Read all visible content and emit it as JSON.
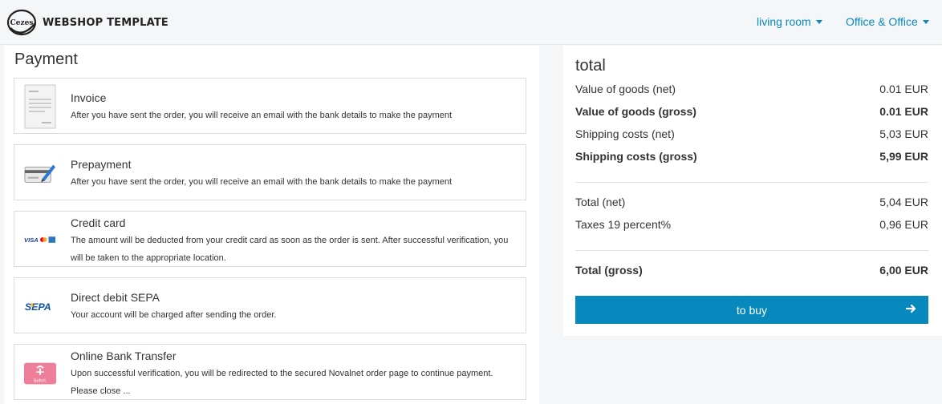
{
  "header": {
    "logo_mark": "Cezes",
    "brand": "WEBSHOP TEMPLATE",
    "nav": [
      {
        "label": "living room"
      },
      {
        "label": "Office & Office"
      }
    ]
  },
  "payment": {
    "title": "Payment",
    "methods": [
      {
        "name": "Invoice",
        "description": "After you have sent the order, you will receive an email with the bank details to make the payment",
        "icon": "invoice-document-icon"
      },
      {
        "name": "Prepayment",
        "description": "After you have sent the order, you will receive an email with the bank details to make the payment",
        "icon": "prepayment-card-pen-icon"
      },
      {
        "name": "Credit card",
        "description": "The amount will be deducted from your credit card as soon as the order is sent. After successful verification, you will be taken to the appropriate location.",
        "icon": "credit-card-logos-icon",
        "icon_text": "VISA"
      },
      {
        "name": "Direct debit SEPA",
        "description": "Your account will be charged after sending the order.",
        "icon": "sepa-logo-icon",
        "icon_text": "SEPA"
      },
      {
        "name": "Online Bank Transfer",
        "description": "Upon successful verification, you will be redirected to the secured Novalnet order page to continue payment. Please close ...",
        "icon": "sofort-logo-icon",
        "icon_text": "Sofort."
      }
    ]
  },
  "totals": {
    "title": "total",
    "rows": [
      {
        "label": "Value of goods (net)",
        "value": "0.01 EUR"
      },
      {
        "label": "Value of goods (gross)",
        "value": "0.01 EUR"
      },
      {
        "label": "Shipping costs (net)",
        "value": "5,03 EUR"
      },
      {
        "label": "Shipping costs (gross)",
        "value": "5,99 EUR"
      },
      {
        "label": "Total (net)",
        "value": "5,04 EUR"
      },
      {
        "label": "Taxes 19 percent%",
        "value": "0,96 EUR"
      },
      {
        "label": "Total (gross)",
        "value": "6,00 EUR"
      }
    ],
    "buy_label": "to buy"
  },
  "colors": {
    "accent": "#0889bd",
    "sepa_blue": "#10529f",
    "sepa_yellow": "#f6b900",
    "sofort_pink": "#ee7f9b"
  }
}
